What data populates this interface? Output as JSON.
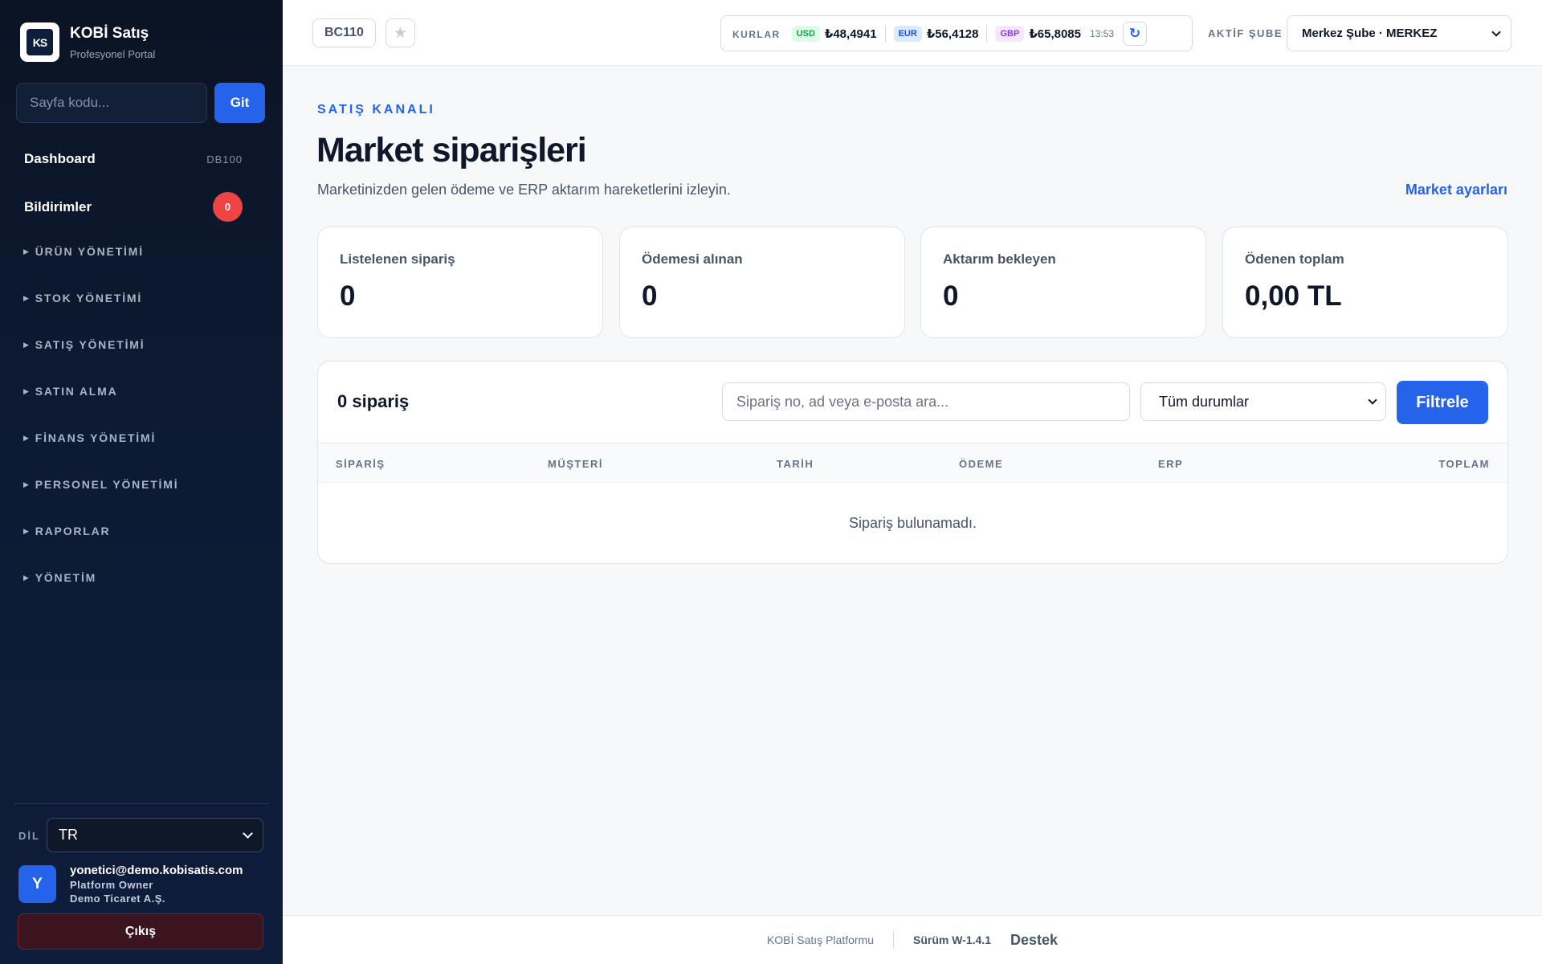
{
  "sidebar": {
    "brand": {
      "name": "KOBİ Satış",
      "subtitle": "Profesyonel Portal",
      "logo_text": "KS"
    },
    "page_search": {
      "placeholder": "Sayfa kodu...",
      "button": "Git"
    },
    "dashboard": {
      "label": "Dashboard",
      "code": "DB100"
    },
    "notifications": {
      "label": "Bildirimler",
      "count": "0"
    },
    "groups": [
      "ÜRÜN YÖNETİMİ",
      "STOK YÖNETİMİ",
      "SATIŞ YÖNETİMİ",
      "SATIN ALMA",
      "FİNANS YÖNETİMİ",
      "PERSONEL YÖNETİMİ",
      "RAPORLAR",
      "YÖNETİM"
    ],
    "language": {
      "label": "DİL",
      "value": "TR"
    },
    "user": {
      "initial": "Y",
      "email": "yonetici@demo.kobisatis.com",
      "role": "Platform Owner",
      "company": "Demo Ticaret A.Ş."
    },
    "logout": "Çıkış"
  },
  "topbar": {
    "page_code": "BC110",
    "rates": {
      "label": "KURLAR",
      "usd": {
        "code": "USD",
        "value": "₺48,4941",
        "color": "#16a34a",
        "bg": "#dcfce7"
      },
      "eur": {
        "code": "EUR",
        "value": "₺56,4128",
        "color": "#1d4ed8",
        "bg": "#dbeafe"
      },
      "gbp": {
        "code": "GBP",
        "value": "₺65,8085",
        "color": "#9333ea",
        "bg": "#f3e8ff"
      },
      "time": "13:53"
    },
    "branch": {
      "label": "AKTİF ŞUBE",
      "value": "Merkez Şube · MERKEZ"
    }
  },
  "main": {
    "eyebrow": "SATIŞ KANALI",
    "title": "Market siparişleri",
    "subtitle": "Marketinizden gelen ödeme ve ERP aktarım hareketlerini izleyin.",
    "settings_link": "Market ayarları",
    "stats": [
      {
        "label": "Listelenen sipariş",
        "value": "0"
      },
      {
        "label": "Ödemesi alınan",
        "value": "0"
      },
      {
        "label": "Aktarım bekleyen",
        "value": "0"
      },
      {
        "label": "Ödenen toplam",
        "value": "0,00 TL"
      }
    ],
    "orders": {
      "count_label": "0 sipariş",
      "search_placeholder": "Sipariş no, ad veya e-posta ara...",
      "status_value": "Tüm durumlar",
      "filter_button": "Filtrele",
      "columns": [
        "SİPARİŞ",
        "MÜŞTERİ",
        "TARİH",
        "ÖDEME",
        "ERP",
        "TOPLAM"
      ],
      "empty": "Sipariş bulunamadı."
    }
  },
  "footer": {
    "brand": "KOBİ Satış Platformu",
    "version": "Sürüm W-1.4.1",
    "support": "Destek"
  },
  "colors": {
    "accent": "#2563eb",
    "sidebar": "#0d1a33",
    "danger": "#ef4444"
  }
}
